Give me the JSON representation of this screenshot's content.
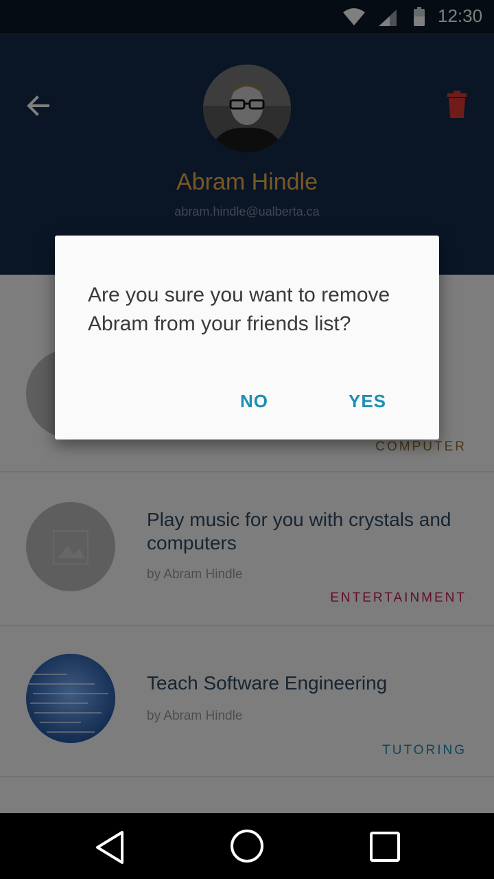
{
  "status_bar": {
    "time": "12:30"
  },
  "header": {
    "back_icon": "arrow-back-icon",
    "delete_icon": "trash-icon",
    "name": "Abram Hindle",
    "email": "abram.hindle@ualberta.ca"
  },
  "list": {
    "items": [
      {
        "title": "",
        "author": "",
        "category": "COMPUTER",
        "category_color": "#9a6a2a"
      },
      {
        "title": "Play music for you with crystals and computers",
        "author": "by Abram Hindle",
        "category": "ENTERTAINMENT",
        "category_color": "#c2185b"
      },
      {
        "title": "Teach Software Engineering",
        "author": "by Abram Hindle",
        "category": "TUTORING",
        "category_color": "#1b8fb4"
      }
    ]
  },
  "dialog": {
    "message": "Are you sure you want to remove Abram from your friends list?",
    "no_label": "NO",
    "yes_label": "YES"
  },
  "colors": {
    "header_bg": "#142c4d",
    "accent": "#f3b14a",
    "dialog_button": "#1b8fb4",
    "delete": "#d32f2f"
  }
}
